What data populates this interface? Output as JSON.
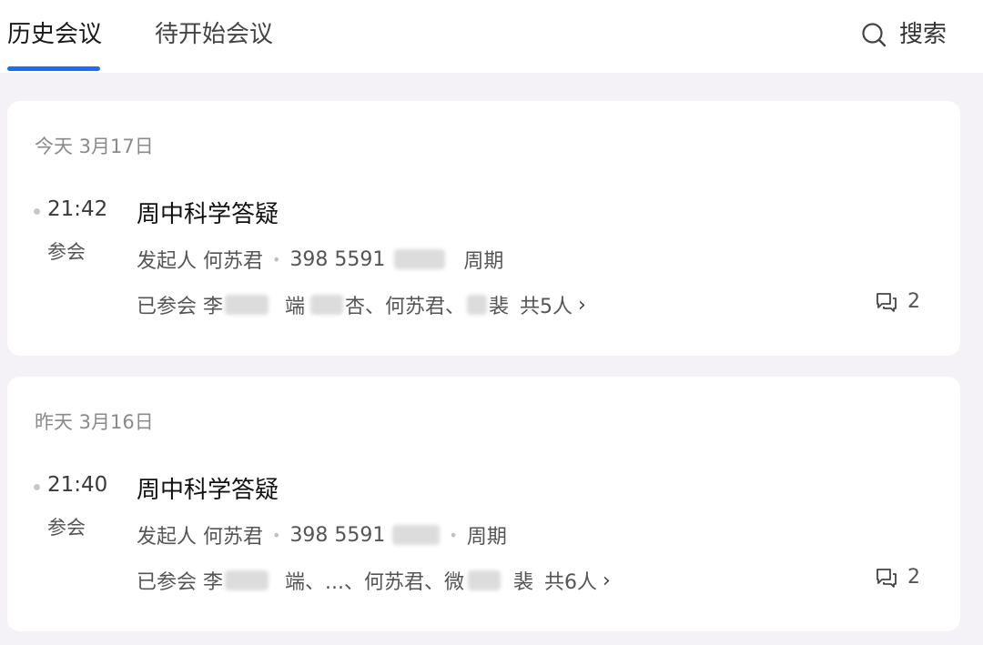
{
  "tabs": {
    "history": "历史会议",
    "upcoming": "待开始会议"
  },
  "search": {
    "label": "搜索"
  },
  "meetings": [
    {
      "day": "今天 3月17日",
      "time": "21:42",
      "status": "参会",
      "title": "周中科学答疑",
      "organizer": "发起人 何苏君",
      "meeting_id": "398 5591",
      "recurrence": "周期",
      "attendees": {
        "prefix": "已参会 李",
        "part_2": "端",
        "part_3": "杏、何苏君、",
        "part_4": "裴",
        "total": "共5人"
      },
      "comments": "2"
    },
    {
      "day": "昨天 3月16日",
      "time": "21:40",
      "status": "参会",
      "title": "周中科学答疑",
      "organizer": "发起人 何苏君",
      "meeting_id": "398 5591",
      "recurrence": "周期",
      "attendees": {
        "prefix": "已参会 李",
        "part_2": "端、...、何苏君、微",
        "part_4": "裴",
        "total": "共6人"
      },
      "comments": "2"
    }
  ],
  "colors": {
    "accent": "#1e6cf0",
    "background": "#f4f2f6",
    "card": "#ffffff"
  }
}
